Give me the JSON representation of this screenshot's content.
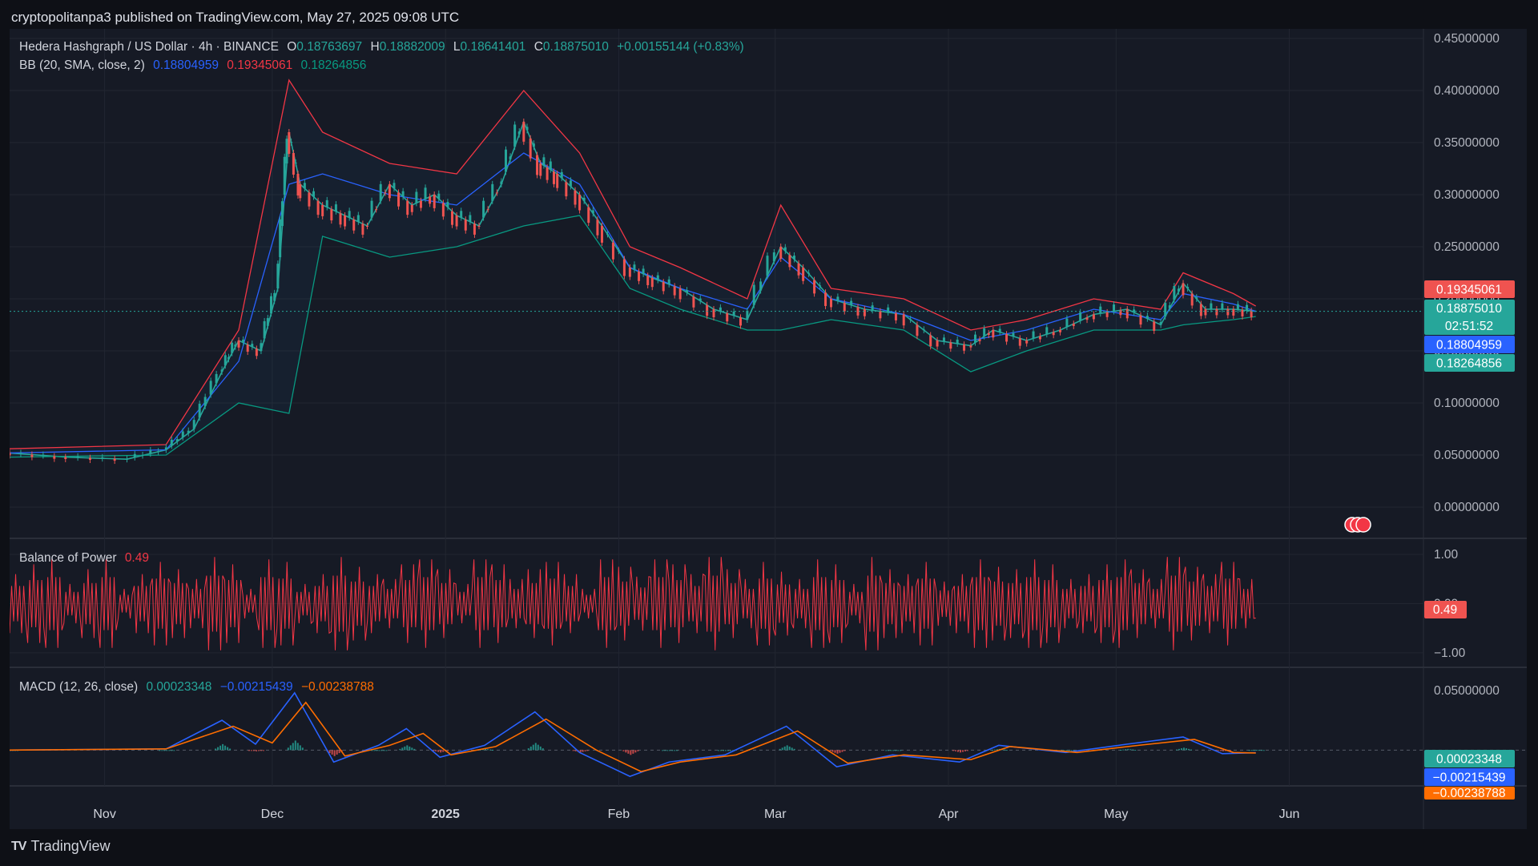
{
  "header": {
    "text": "cryptopolitanpa3 published on TradingView.com, May 27, 2025 09:08 UTC"
  },
  "footer": {
    "brand": "TradingView",
    "logo_text": "TV"
  },
  "main_legend": {
    "symbol": "Hedera Hashgraph / US Dollar · 4h · BINANCE",
    "o_label": "O",
    "o": "0.18763697",
    "h_label": "H",
    "h": "0.18882009",
    "l_label": "L",
    "l": "0.18641401",
    "c_label": "C",
    "c": "0.18875010",
    "change": "+0.00155144 (+0.83%)"
  },
  "bb_legend": {
    "label": "BB (20, SMA, close, 2)",
    "basis": "0.18804959",
    "upper": "0.19345061",
    "lower": "0.18264856"
  },
  "bop_legend": {
    "label": "Balance of Power",
    "value": "0.49"
  },
  "macd_legend": {
    "label": "MACD (12, 26, close)",
    "hist": "0.00023348",
    "macd": "−0.00215439",
    "signal": "−0.00238788"
  },
  "price_tags": {
    "upper": "0.19345061",
    "last": "0.18875010",
    "countdown": "02:51:52",
    "basis": "0.18804959",
    "lower": "0.18264856",
    "bop": "0.49",
    "macd_hist": "0.00023348",
    "macd_line": "−0.00215439",
    "macd_signal": "−0.00238788"
  },
  "colors": {
    "background": "#161a25",
    "grid": "#222631",
    "up": "#26a69a",
    "down": "#ef5350",
    "bb_basis": "#2962ff",
    "bb_upper": "#f23645",
    "bb_lower": "#089981",
    "macd_line": "#2962ff",
    "signal_line": "#ff6d00",
    "bop": "#f23645"
  },
  "chart_data": [
    {
      "type": "line",
      "title": "Hedera Hashgraph / US Dollar · 4h · BINANCE",
      "x_ticks": [
        "Nov",
        "Dec",
        "2025",
        "Feb",
        "Mar",
        "Apr",
        "May",
        "Jun"
      ],
      "y_ticks": [
        "0.45000000",
        "0.40000000",
        "0.35000000",
        "0.30000000",
        "0.25000000",
        "0.20000000",
        "0.15000000",
        "0.10000000",
        "0.05000000",
        "0.00000000"
      ],
      "ylim": [
        -0.03,
        0.45
      ],
      "series": [
        {
          "name": "Price",
          "x": [
            "Oct 15",
            "Oct 25",
            "Nov 5",
            "Nov 12",
            "Nov 17",
            "Nov 22",
            "Nov 25",
            "Nov 29",
            "Dec 2",
            "Dec 4",
            "Dec 6",
            "Dec 10",
            "Dec 14",
            "Dec 18",
            "Dec 22",
            "Dec 26",
            "Dec 30",
            "Jan 3",
            "Jan 7",
            "Jan 11",
            "Jan 15",
            "Jan 18",
            "Jan 21",
            "Jan 25",
            "Jan 29",
            "Feb 3",
            "Feb 7",
            "Feb 12",
            "Feb 18",
            "Feb 24",
            "Mar 2",
            "Mar 6",
            "Mar 11",
            "Mar 17",
            "Mar 24",
            "Mar 30",
            "Apr 5",
            "Apr 9",
            "Apr 15",
            "Apr 21",
            "Apr 27",
            "May 3",
            "May 9",
            "May 13",
            "May 17",
            "May 22",
            "May 26"
          ],
          "values": [
            0.052,
            0.048,
            0.046,
            0.055,
            0.075,
            0.13,
            0.16,
            0.15,
            0.21,
            0.36,
            0.31,
            0.29,
            0.28,
            0.27,
            0.31,
            0.29,
            0.3,
            0.28,
            0.27,
            0.31,
            0.37,
            0.33,
            0.32,
            0.3,
            0.27,
            0.23,
            0.22,
            0.21,
            0.19,
            0.18,
            0.25,
            0.23,
            0.2,
            0.19,
            0.185,
            0.16,
            0.155,
            0.17,
            0.16,
            0.17,
            0.185,
            0.19,
            0.175,
            0.215,
            0.19,
            0.19,
            0.188
          ]
        },
        {
          "name": "BB Upper",
          "x": [
            "Oct 15",
            "Nov 12",
            "Nov 25",
            "Dec 4",
            "Dec 10",
            "Dec 22",
            "Jan 3",
            "Jan 15",
            "Jan 25",
            "Feb 3",
            "Feb 12",
            "Feb 24",
            "Mar 2",
            "Mar 11",
            "Mar 24",
            "Apr 5",
            "Apr 15",
            "Apr 27",
            "May 9",
            "May 13",
            "May 22",
            "May 26"
          ],
          "values": [
            0.056,
            0.06,
            0.17,
            0.41,
            0.36,
            0.33,
            0.32,
            0.4,
            0.34,
            0.25,
            0.23,
            0.2,
            0.29,
            0.21,
            0.2,
            0.17,
            0.18,
            0.2,
            0.19,
            0.225,
            0.205,
            0.193
          ]
        },
        {
          "name": "BB Basis",
          "x": [
            "Oct 15",
            "Nov 12",
            "Nov 25",
            "Dec 4",
            "Dec 10",
            "Dec 22",
            "Jan 3",
            "Jan 15",
            "Jan 25",
            "Feb 3",
            "Feb 12",
            "Feb 24",
            "Mar 2",
            "Mar 11",
            "Mar 24",
            "Apr 5",
            "Apr 15",
            "Apr 27",
            "May 9",
            "May 13",
            "May 22",
            "May 26"
          ],
          "values": [
            0.052,
            0.055,
            0.14,
            0.31,
            0.32,
            0.3,
            0.29,
            0.34,
            0.31,
            0.23,
            0.21,
            0.19,
            0.24,
            0.2,
            0.185,
            0.16,
            0.17,
            0.19,
            0.18,
            0.205,
            0.195,
            0.188
          ]
        },
        {
          "name": "BB Lower",
          "x": [
            "Oct 15",
            "Nov 12",
            "Nov 25",
            "Dec 4",
            "Dec 10",
            "Dec 22",
            "Jan 3",
            "Jan 15",
            "Jan 25",
            "Feb 3",
            "Feb 12",
            "Feb 24",
            "Mar 2",
            "Mar 11",
            "Mar 24",
            "Apr 5",
            "Apr 15",
            "Apr 27",
            "May 9",
            "May 13",
            "May 22",
            "May 26"
          ],
          "values": [
            0.048,
            0.05,
            0.1,
            0.09,
            0.26,
            0.24,
            0.25,
            0.27,
            0.28,
            0.21,
            0.19,
            0.17,
            0.17,
            0.18,
            0.17,
            0.13,
            0.15,
            0.17,
            0.17,
            0.175,
            0.18,
            0.183
          ]
        }
      ]
    },
    {
      "type": "bar",
      "title": "Balance of Power",
      "y_ticks": [
        "1.00",
        "0.00",
        "−1.00"
      ],
      "ylim": [
        -1.1,
        1.1
      ],
      "series": [
        {
          "name": "Balance of Power",
          "values": [
            0.6,
            -0.8,
            0.9,
            -0.4,
            0.7,
            -0.9,
            0.3,
            -0.6,
            0.85,
            -0.7,
            0.5,
            -0.95,
            0.8,
            -0.3,
            0.9,
            -0.85,
            0.4,
            -0.6,
            0.95,
            -0.75,
            0.6,
            -0.5,
            0.8,
            -0.9,
            0.7,
            -0.4,
            0.9,
            -0.8,
            0.5,
            -0.7,
            0.85,
            -0.6,
            0.3,
            -0.9,
            0.75,
            -0.55,
            0.9,
            -0.8,
            0.6,
            -0.95,
            0.7,
            -0.5,
            0.85,
            -0.65,
            0.5,
            -0.9,
            0.8,
            -0.4,
            0.95,
            -0.7,
            0.6,
            -0.85,
            0.45,
            -0.6,
            0.9,
            -0.75,
            0.7,
            -0.9,
            0.8,
            -0.5,
            0.6,
            -0.8,
            0.9,
            -0.7,
            0.5,
            -0.95,
            0.75,
            -0.6,
            0.85,
            -0.5,
            0.49
          ]
        }
      ]
    },
    {
      "type": "line",
      "title": "MACD (12, 26, close)",
      "y_ticks": [
        "0.05000000"
      ],
      "ylim": [
        -0.03,
        0.06
      ],
      "series": [
        {
          "name": "MACD",
          "x": [
            "Oct 15",
            "Nov 12",
            "Nov 22",
            "Nov 28",
            "Dec 5",
            "Dec 12",
            "Dec 20",
            "Dec 25",
            "Dec 31",
            "Jan 8",
            "Jan 17",
            "Jan 25",
            "Feb 3",
            "Feb 10",
            "Feb 20",
            "Mar 3",
            "Mar 12",
            "Mar 22",
            "Apr 3",
            "Apr 10",
            "Apr 22",
            "May 3",
            "May 13",
            "May 20",
            "May 26"
          ],
          "values": [
            0.0,
            0.001,
            0.025,
            0.005,
            0.048,
            -0.01,
            0.004,
            0.018,
            -0.006,
            0.004,
            0.032,
            -0.002,
            -0.022,
            -0.01,
            -0.004,
            0.02,
            -0.014,
            -0.004,
            -0.01,
            0.004,
            -0.002,
            0.005,
            0.011,
            -0.003,
            -0.00215439
          ]
        },
        {
          "name": "Signal",
          "x": [
            "Oct 15",
            "Nov 12",
            "Nov 24",
            "Dec 1",
            "Dec 7",
            "Dec 14",
            "Dec 22",
            "Dec 28",
            "Jan 2",
            "Jan 10",
            "Jan 19",
            "Jan 28",
            "Feb 5",
            "Feb 12",
            "Feb 22",
            "Mar 5",
            "Mar 14",
            "Mar 24",
            "Apr 5",
            "Apr 12",
            "Apr 24",
            "May 5",
            "May 15",
            "May 22",
            "May 26"
          ],
          "values": [
            0.0,
            0.001,
            0.02,
            0.006,
            0.04,
            -0.005,
            0.004,
            0.014,
            -0.004,
            0.003,
            0.026,
            0.0,
            -0.018,
            -0.01,
            -0.004,
            0.016,
            -0.011,
            -0.004,
            -0.008,
            0.003,
            -0.002,
            0.004,
            0.009,
            -0.002,
            -0.00238788
          ]
        }
      ]
    }
  ]
}
